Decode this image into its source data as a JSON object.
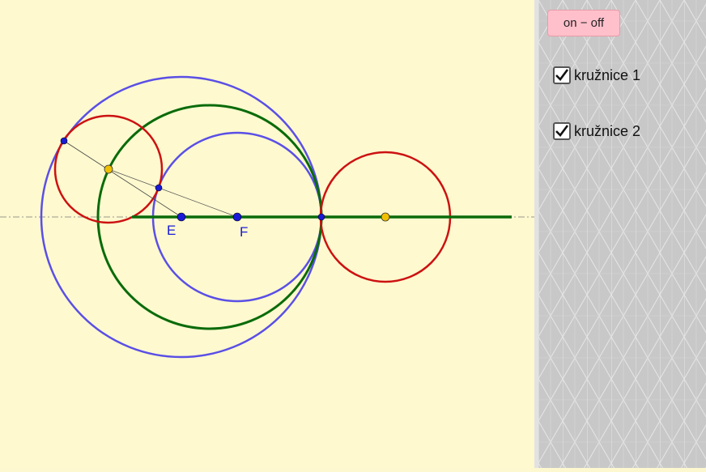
{
  "controls": {
    "toggle_button": "on − off",
    "checkbox_1": {
      "label": "kružnice 1",
      "checked": true
    },
    "checkbox_2": {
      "label": "kružnice 2",
      "checked": true
    }
  },
  "points": {
    "E": "E",
    "F": "F"
  },
  "colors": {
    "canvas_bg": "#fef9cf",
    "blue_circle": "#5a4fe6",
    "red_circle": "#cc1111",
    "green": "#0a6b0a",
    "point_blue": "#1a1ad6",
    "point_yellow": "#f0c000",
    "button_bg": "#ffc0cb",
    "panel_bg": "#c8c8c8"
  },
  "icons": {
    "check": "check-icon"
  }
}
